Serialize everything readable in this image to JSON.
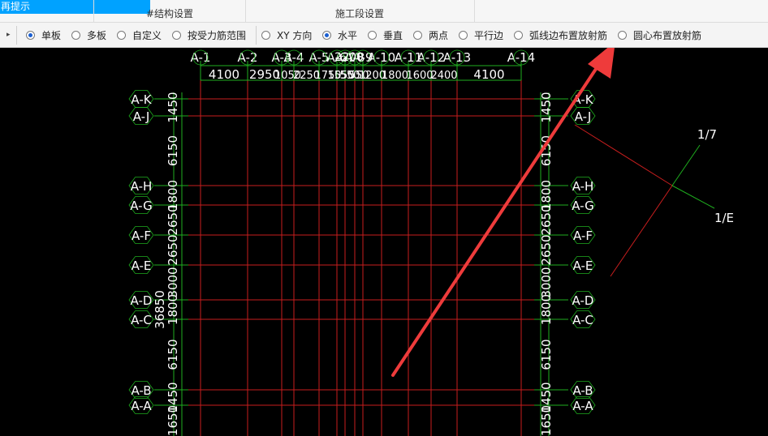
{
  "top_bar": {
    "tip": "再提示",
    "tab_structure": "#结构设置",
    "tab_construction": "施工段设置"
  },
  "toolbar": {
    "layout_mode": [
      {
        "label": "单板",
        "checked": true
      },
      {
        "label": "多板",
        "checked": false
      },
      {
        "label": "自定义",
        "checked": false
      },
      {
        "label": "按受力筋范围",
        "checked": false
      }
    ],
    "direction": [
      {
        "label": "XY 方向",
        "checked": false
      },
      {
        "label": "水平",
        "checked": true
      },
      {
        "label": "垂直",
        "checked": false
      },
      {
        "label": "两点",
        "checked": false
      },
      {
        "label": "平行边",
        "checked": false
      },
      {
        "label": "弧线边布置放射筋",
        "checked": false
      },
      {
        "label": "圆心布置放射筋",
        "checked": false
      }
    ]
  },
  "cad": {
    "colors": {
      "grid": "#c81e1e",
      "dim": "#1fae1f",
      "text": "#ffffff",
      "arrow": "#ee3b3b"
    },
    "axis_x": [
      "A-1",
      "A-2",
      "A-3",
      "A-4",
      "A-5",
      "A-6",
      "A-7",
      "A-8",
      "A-9",
      "A-10",
      "A-11",
      "A-12",
      "A-13",
      "A-14"
    ],
    "axis_x_spans": [
      "4100",
      "2950",
      "1050",
      "2250",
      "1750",
      "1550",
      "550",
      "550",
      "1200",
      "1800",
      "1600",
      "2400",
      "4100"
    ],
    "axis_x_overlap_label": "2200",
    "axis_y": [
      "A-K",
      "A-J",
      "A-H",
      "A-G",
      "A-F",
      "A-E",
      "A-D",
      "A-C",
      "A-B",
      "A-A"
    ],
    "axis_y_spans": [
      "1450",
      "6150",
      "1800",
      "2650",
      "2650",
      "3000",
      "1800",
      "6150",
      "1450",
      "1650"
    ],
    "axis_y_total": "36850",
    "section_labels": [
      "1/7",
      "1/E"
    ]
  }
}
